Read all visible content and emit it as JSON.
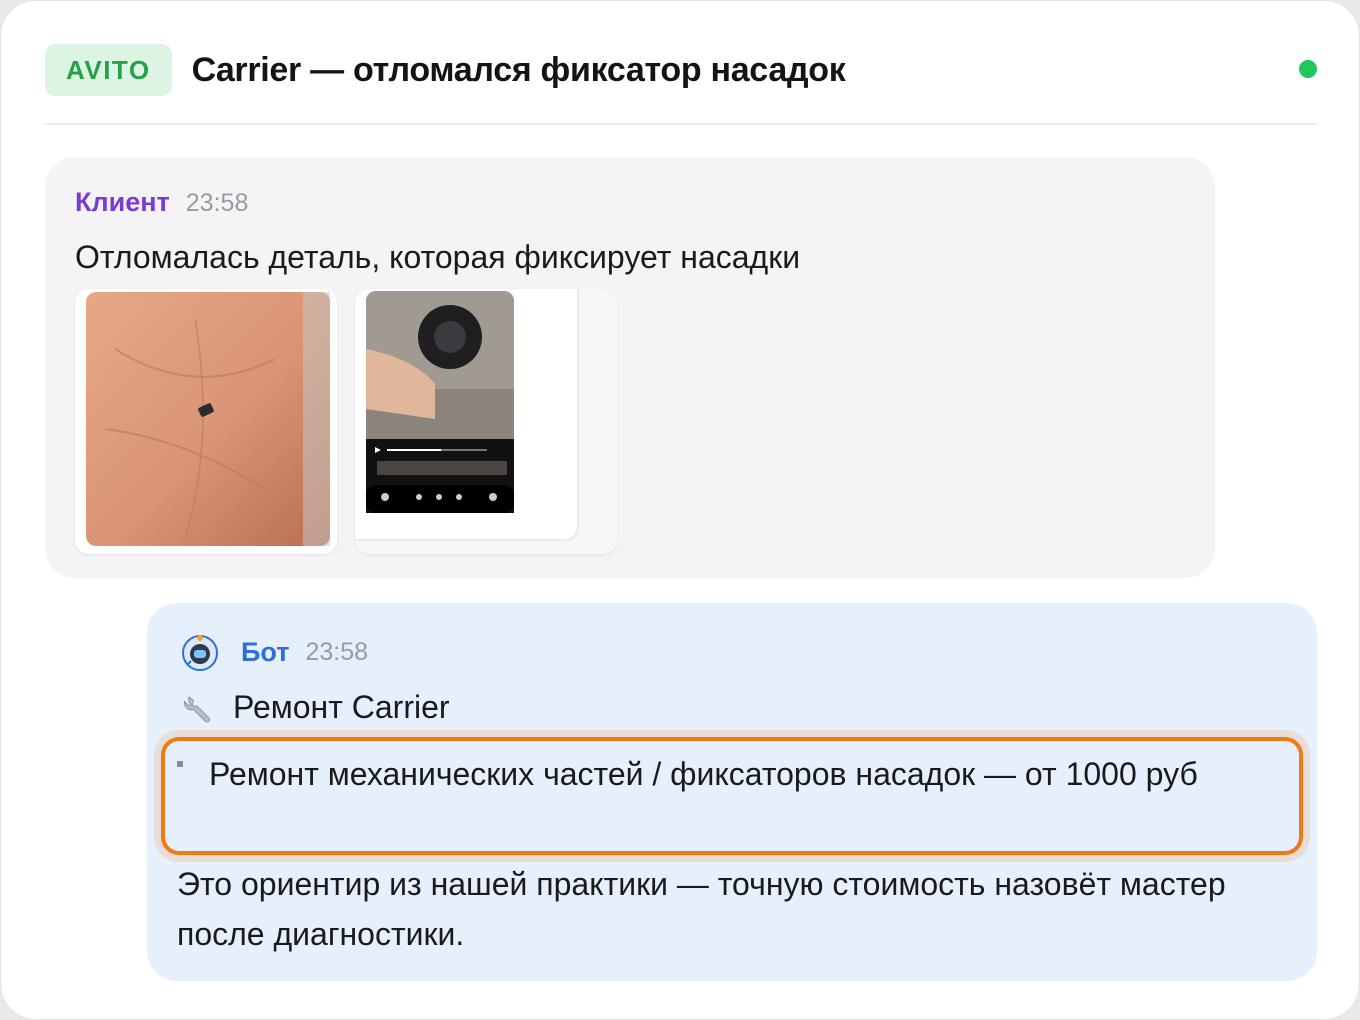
{
  "header": {
    "source_badge": "AVITO",
    "title": "Carrier — отломался фиксатор насадок",
    "status_color": "#22c55e"
  },
  "client_message": {
    "author": "Клиент",
    "time": "23:58",
    "text": "Отломалась деталь, которая фиксирует насадки",
    "attachments": [
      {
        "kind": "photo",
        "icon": "photo-palm-icon"
      },
      {
        "kind": "video-screenshot",
        "icon": "video-screenshot-icon"
      }
    ]
  },
  "bot_message": {
    "author": "Бот",
    "time": "23:58",
    "service_title": "Ремонт Carrier",
    "price_item": "Ремонт механических частей / фиксаторов насадок — от 1000 руб",
    "note": "Это ориентир из нашей практики — точную стоимость назовёт мастер после диагностики."
  },
  "colors": {
    "client_author": "#7c3ad8",
    "bot_author": "#2f6fd6",
    "highlight": "#f07a14",
    "badge_bg": "#dcf5e3",
    "badge_text": "#27a04a"
  }
}
